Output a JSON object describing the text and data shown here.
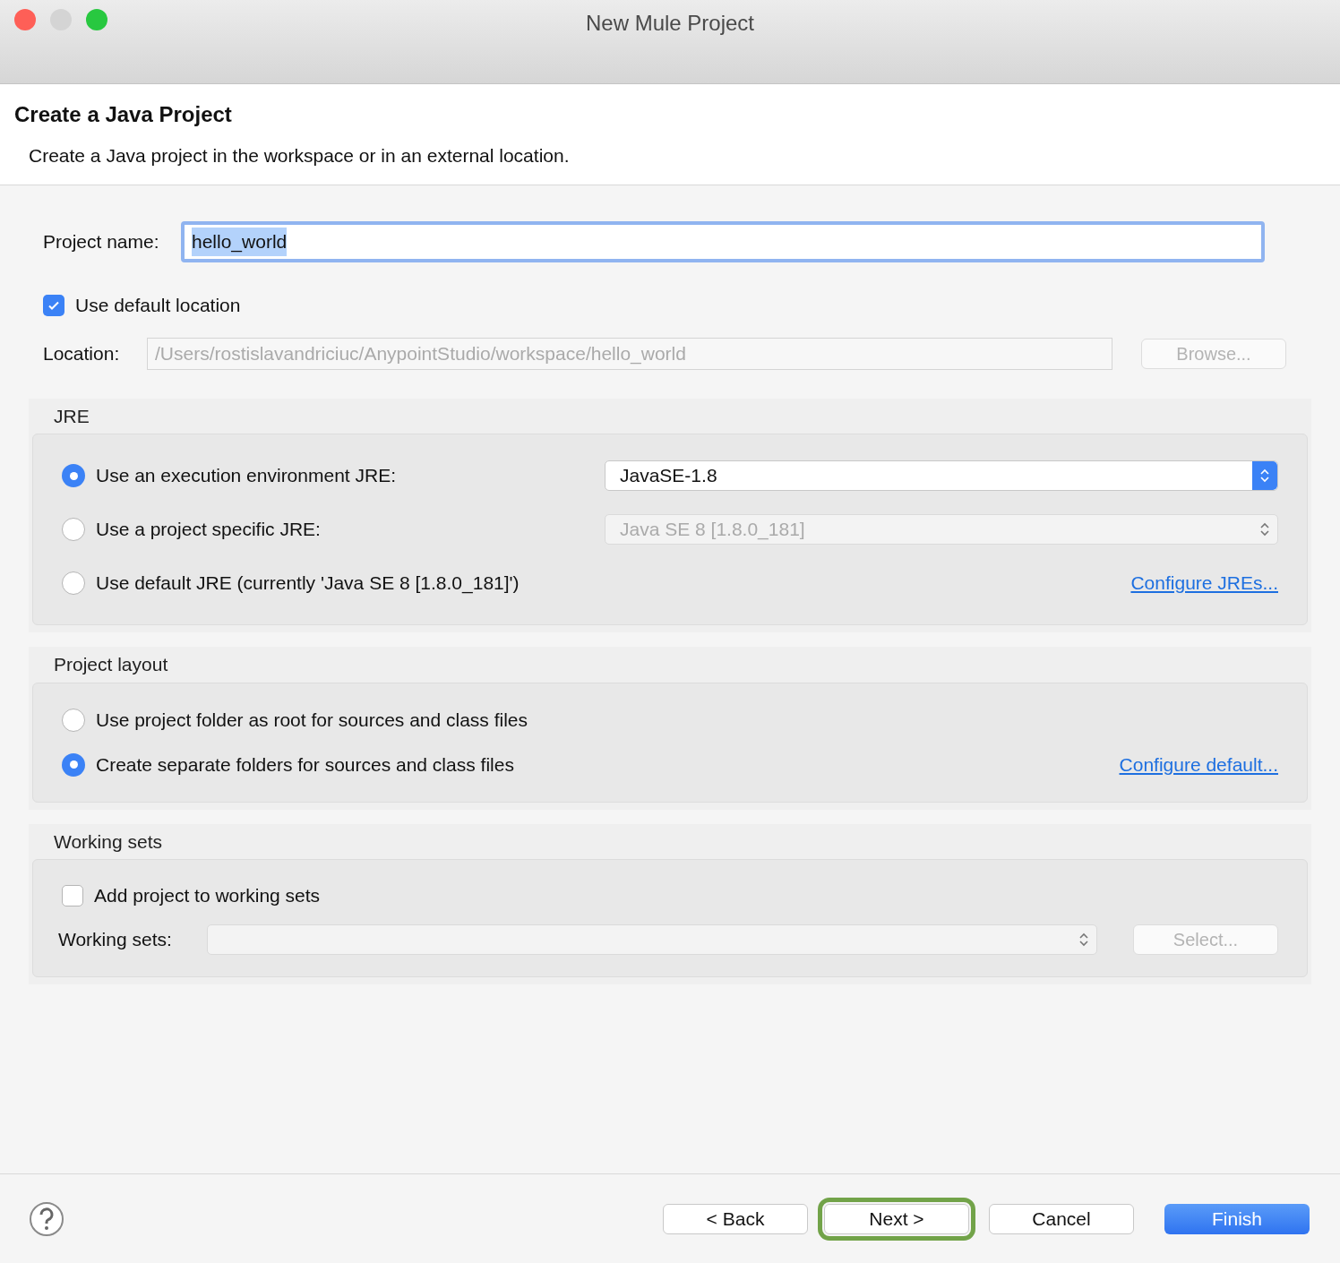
{
  "window": {
    "title": "New Mule Project"
  },
  "header": {
    "title": "Create a Java Project",
    "description": "Create a Java project in the workspace or in an external location."
  },
  "project_name": {
    "label": "Project name:",
    "value": "hello_world"
  },
  "default_location": {
    "label": "Use default location",
    "checked": true
  },
  "location": {
    "label": "Location:",
    "value": "/Users/rostislavandriciuc/AnypointStudio/workspace/hello_world",
    "disabled": true
  },
  "browse_button": {
    "label": "Browse...",
    "disabled": true
  },
  "jre": {
    "title": "JRE",
    "options": [
      {
        "label": "Use an execution environment JRE:",
        "selected": true,
        "select": "JavaSE-1.8"
      },
      {
        "label": "Use a project specific JRE:",
        "selected": false,
        "select": "Java SE 8 [1.8.0_181]"
      },
      {
        "label": "Use default JRE (currently 'Java SE 8 [1.8.0_181]')",
        "selected": false
      }
    ],
    "link": "Configure JREs..."
  },
  "project_layout": {
    "title": "Project layout",
    "options": [
      {
        "label": "Use project folder as root for sources and class files",
        "selected": false
      },
      {
        "label": "Create separate folders for sources and class files",
        "selected": true
      }
    ],
    "link": "Configure default..."
  },
  "working_sets": {
    "title": "Working sets",
    "add": {
      "label": "Add project to working sets",
      "checked": false
    },
    "label": "Working sets:",
    "select_button": "Select..."
  },
  "buttons": [
    {
      "label": "< Back",
      "kind": "default"
    },
    {
      "label": "Next >",
      "kind": "highlighted"
    },
    {
      "label": "Cancel",
      "kind": "default"
    },
    {
      "label": "Finish",
      "kind": "primary"
    }
  ]
}
